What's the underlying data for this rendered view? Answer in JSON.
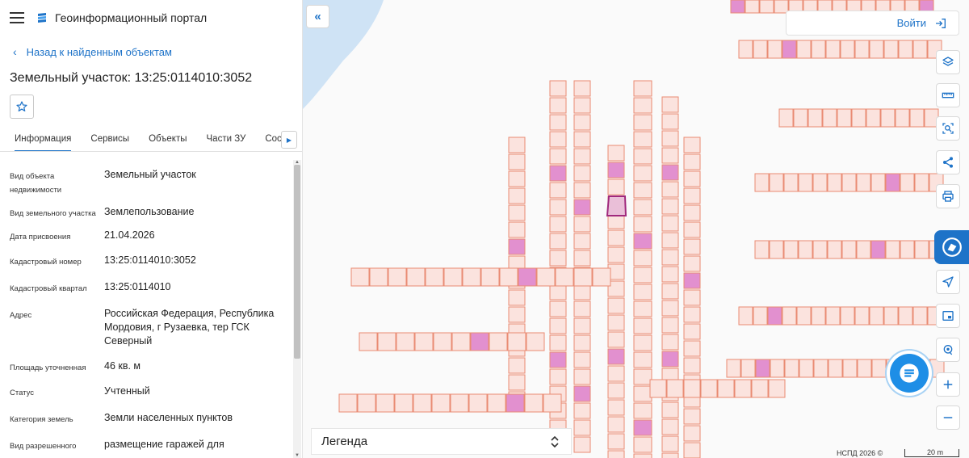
{
  "header": {
    "portal_title": "Геоинформационный портал"
  },
  "back_link": "Назад к найденным объектам",
  "parcel_title": "Земельный участок: 13:25:0114010:3052",
  "tabs": [
    {
      "label": "Информация"
    },
    {
      "label": "Сервисы"
    },
    {
      "label": "Объекты"
    },
    {
      "label": "Части ЗУ"
    },
    {
      "label": "Состав"
    }
  ],
  "info_rows": [
    {
      "key": "Вид объекта недвижимости",
      "value": "Земельный участок"
    },
    {
      "key": "Вид земельного участка",
      "value": "Землепользование"
    },
    {
      "key": "Дата присвоения",
      "value": "21.04.2026"
    },
    {
      "key": "Кадастровый номер",
      "value": "13:25:0114010:3052"
    },
    {
      "key": "Кадастровый квартал",
      "value": "13:25:0114010"
    },
    {
      "key": "Адрес",
      "value": "Российская Федерация, Республика Мордовия, г Рузаевка, тер ГСК Северный"
    },
    {
      "key": "Площадь уточненная",
      "value": "46 кв. м"
    },
    {
      "key": "Статус",
      "value": "Учтенный"
    },
    {
      "key": "Категория земель",
      "value": "Земли населенных пунктов"
    },
    {
      "key": "Вид разрешенного",
      "value": "размещение гаражей для"
    }
  ],
  "map": {
    "login_label": "Войти",
    "legend_label": "Легенда",
    "attribution": "НСПД 2026 ©",
    "scale_label": "20 m",
    "colors": {
      "parcel_fill": "#fbe3de",
      "parcel_stroke": "#e98b73",
      "selected_fill": "#e290cf",
      "water": "#cfe3f5",
      "accent": "#1e73c8"
    }
  },
  "icons": [
    "menu-icon",
    "portal-logo-icon",
    "chevron-left-icon",
    "star-icon",
    "chevron-right-icon",
    "double-chevron-left-icon",
    "login-icon",
    "layers-icon",
    "ruler-icon",
    "select-area-icon",
    "share-icon",
    "print-icon",
    "nspd-icon",
    "navigate-icon",
    "minimap-icon",
    "location-icon",
    "zoom-in-icon",
    "zoom-out-icon",
    "chat-icon",
    "chevron-up-down-icon"
  ]
}
